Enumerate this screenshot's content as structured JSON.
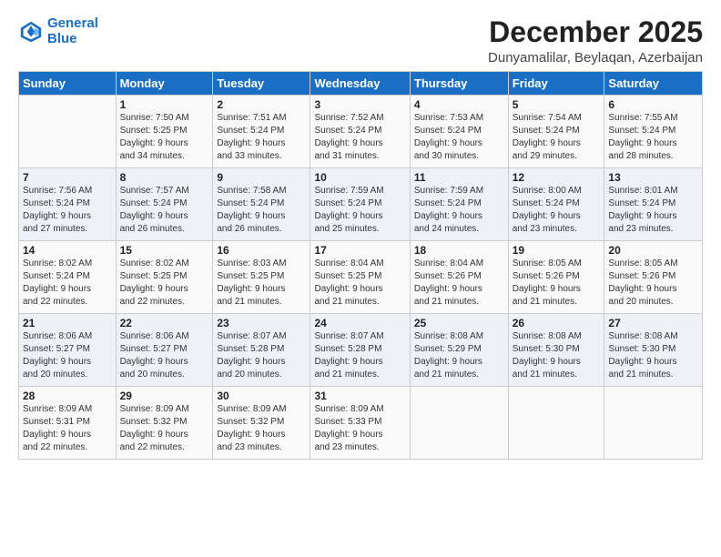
{
  "logo": {
    "line1": "General",
    "line2": "Blue"
  },
  "title": "December 2025",
  "location": "Dunyamalilar, Beylaqan, Azerbaijan",
  "weekdays": [
    "Sunday",
    "Monday",
    "Tuesday",
    "Wednesday",
    "Thursday",
    "Friday",
    "Saturday"
  ],
  "weeks": [
    [
      {
        "day": "",
        "info": ""
      },
      {
        "day": "1",
        "info": "Sunrise: 7:50 AM\nSunset: 5:25 PM\nDaylight: 9 hours\nand 34 minutes."
      },
      {
        "day": "2",
        "info": "Sunrise: 7:51 AM\nSunset: 5:24 PM\nDaylight: 9 hours\nand 33 minutes."
      },
      {
        "day": "3",
        "info": "Sunrise: 7:52 AM\nSunset: 5:24 PM\nDaylight: 9 hours\nand 31 minutes."
      },
      {
        "day": "4",
        "info": "Sunrise: 7:53 AM\nSunset: 5:24 PM\nDaylight: 9 hours\nand 30 minutes."
      },
      {
        "day": "5",
        "info": "Sunrise: 7:54 AM\nSunset: 5:24 PM\nDaylight: 9 hours\nand 29 minutes."
      },
      {
        "day": "6",
        "info": "Sunrise: 7:55 AM\nSunset: 5:24 PM\nDaylight: 9 hours\nand 28 minutes."
      }
    ],
    [
      {
        "day": "7",
        "info": "Sunrise: 7:56 AM\nSunset: 5:24 PM\nDaylight: 9 hours\nand 27 minutes."
      },
      {
        "day": "8",
        "info": "Sunrise: 7:57 AM\nSunset: 5:24 PM\nDaylight: 9 hours\nand 26 minutes."
      },
      {
        "day": "9",
        "info": "Sunrise: 7:58 AM\nSunset: 5:24 PM\nDaylight: 9 hours\nand 26 minutes."
      },
      {
        "day": "10",
        "info": "Sunrise: 7:59 AM\nSunset: 5:24 PM\nDaylight: 9 hours\nand 25 minutes."
      },
      {
        "day": "11",
        "info": "Sunrise: 7:59 AM\nSunset: 5:24 PM\nDaylight: 9 hours\nand 24 minutes."
      },
      {
        "day": "12",
        "info": "Sunrise: 8:00 AM\nSunset: 5:24 PM\nDaylight: 9 hours\nand 23 minutes."
      },
      {
        "day": "13",
        "info": "Sunrise: 8:01 AM\nSunset: 5:24 PM\nDaylight: 9 hours\nand 23 minutes."
      }
    ],
    [
      {
        "day": "14",
        "info": "Sunrise: 8:02 AM\nSunset: 5:24 PM\nDaylight: 9 hours\nand 22 minutes."
      },
      {
        "day": "15",
        "info": "Sunrise: 8:02 AM\nSunset: 5:25 PM\nDaylight: 9 hours\nand 22 minutes."
      },
      {
        "day": "16",
        "info": "Sunrise: 8:03 AM\nSunset: 5:25 PM\nDaylight: 9 hours\nand 21 minutes."
      },
      {
        "day": "17",
        "info": "Sunrise: 8:04 AM\nSunset: 5:25 PM\nDaylight: 9 hours\nand 21 minutes."
      },
      {
        "day": "18",
        "info": "Sunrise: 8:04 AM\nSunset: 5:26 PM\nDaylight: 9 hours\nand 21 minutes."
      },
      {
        "day": "19",
        "info": "Sunrise: 8:05 AM\nSunset: 5:26 PM\nDaylight: 9 hours\nand 21 minutes."
      },
      {
        "day": "20",
        "info": "Sunrise: 8:05 AM\nSunset: 5:26 PM\nDaylight: 9 hours\nand 20 minutes."
      }
    ],
    [
      {
        "day": "21",
        "info": "Sunrise: 8:06 AM\nSunset: 5:27 PM\nDaylight: 9 hours\nand 20 minutes."
      },
      {
        "day": "22",
        "info": "Sunrise: 8:06 AM\nSunset: 5:27 PM\nDaylight: 9 hours\nand 20 minutes."
      },
      {
        "day": "23",
        "info": "Sunrise: 8:07 AM\nSunset: 5:28 PM\nDaylight: 9 hours\nand 20 minutes."
      },
      {
        "day": "24",
        "info": "Sunrise: 8:07 AM\nSunset: 5:28 PM\nDaylight: 9 hours\nand 21 minutes."
      },
      {
        "day": "25",
        "info": "Sunrise: 8:08 AM\nSunset: 5:29 PM\nDaylight: 9 hours\nand 21 minutes."
      },
      {
        "day": "26",
        "info": "Sunrise: 8:08 AM\nSunset: 5:30 PM\nDaylight: 9 hours\nand 21 minutes."
      },
      {
        "day": "27",
        "info": "Sunrise: 8:08 AM\nSunset: 5:30 PM\nDaylight: 9 hours\nand 21 minutes."
      }
    ],
    [
      {
        "day": "28",
        "info": "Sunrise: 8:09 AM\nSunset: 5:31 PM\nDaylight: 9 hours\nand 22 minutes."
      },
      {
        "day": "29",
        "info": "Sunrise: 8:09 AM\nSunset: 5:32 PM\nDaylight: 9 hours\nand 22 minutes."
      },
      {
        "day": "30",
        "info": "Sunrise: 8:09 AM\nSunset: 5:32 PM\nDaylight: 9 hours\nand 23 minutes."
      },
      {
        "day": "31",
        "info": "Sunrise: 8:09 AM\nSunset: 5:33 PM\nDaylight: 9 hours\nand 23 minutes."
      },
      {
        "day": "",
        "info": ""
      },
      {
        "day": "",
        "info": ""
      },
      {
        "day": "",
        "info": ""
      }
    ]
  ]
}
